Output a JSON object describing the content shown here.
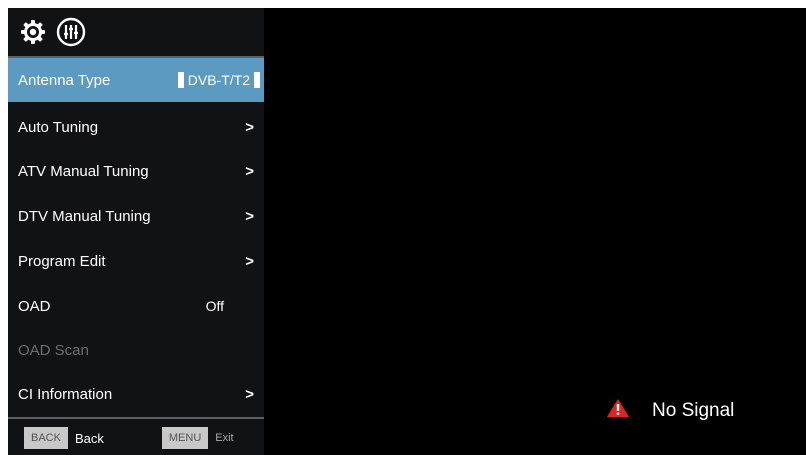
{
  "menu": {
    "top_icons": [
      "gear-icon",
      "equalizer-icon"
    ],
    "items": [
      {
        "label": "Antenna Type",
        "value": "DVB-T/T2"
      },
      {
        "label": "Auto Tuning",
        "arrow": ">"
      },
      {
        "label": "ATV Manual Tuning",
        "arrow": ">"
      },
      {
        "label": "DTV Manual Tuning",
        "arrow": ">"
      },
      {
        "label": "Program Edit",
        "arrow": ">"
      },
      {
        "label": "OAD",
        "value": "Off"
      },
      {
        "label": "OAD Scan"
      },
      {
        "label": "CI Information",
        "arrow": ">"
      }
    ]
  },
  "footer": {
    "back_key": "BACK",
    "back_label": "Back",
    "menu_key": "MENU",
    "menu_label": "Exit"
  },
  "status": {
    "icon": "warning-icon",
    "text": "No Signal"
  },
  "colors": {
    "selected_bg": "#5c9ac2",
    "menu_bg": "#111214",
    "warning": "#e0231e"
  }
}
